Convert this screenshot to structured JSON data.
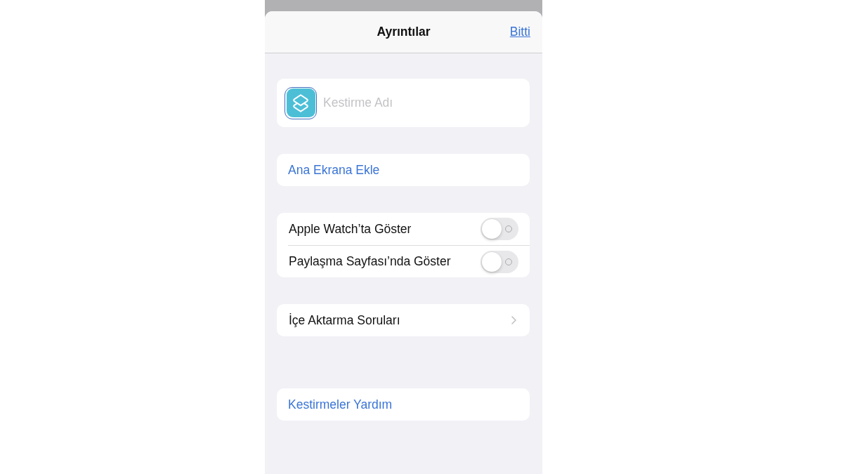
{
  "sheet": {
    "title": "Ayrıntılar",
    "done_button": "Bitti"
  },
  "name_field": {
    "placeholder": "Kestirme Adı"
  },
  "sections": [
    {
      "rows": [
        {
          "kind": "action",
          "label": "Ana Ekrana Ekle"
        }
      ]
    },
    {
      "rows": [
        {
          "kind": "toggle",
          "label": "Apple Watch’ta Göster",
          "on": false
        },
        {
          "kind": "toggle",
          "label": "Paylaşma Sayfası’nda Göster",
          "on": false
        }
      ]
    },
    {
      "rows": [
        {
          "kind": "link",
          "label": "İçe Aktarma Soruları"
        }
      ]
    },
    {
      "rows": [
        {
          "kind": "action",
          "label": "Kestirmeler Yardım"
        }
      ]
    }
  ]
}
